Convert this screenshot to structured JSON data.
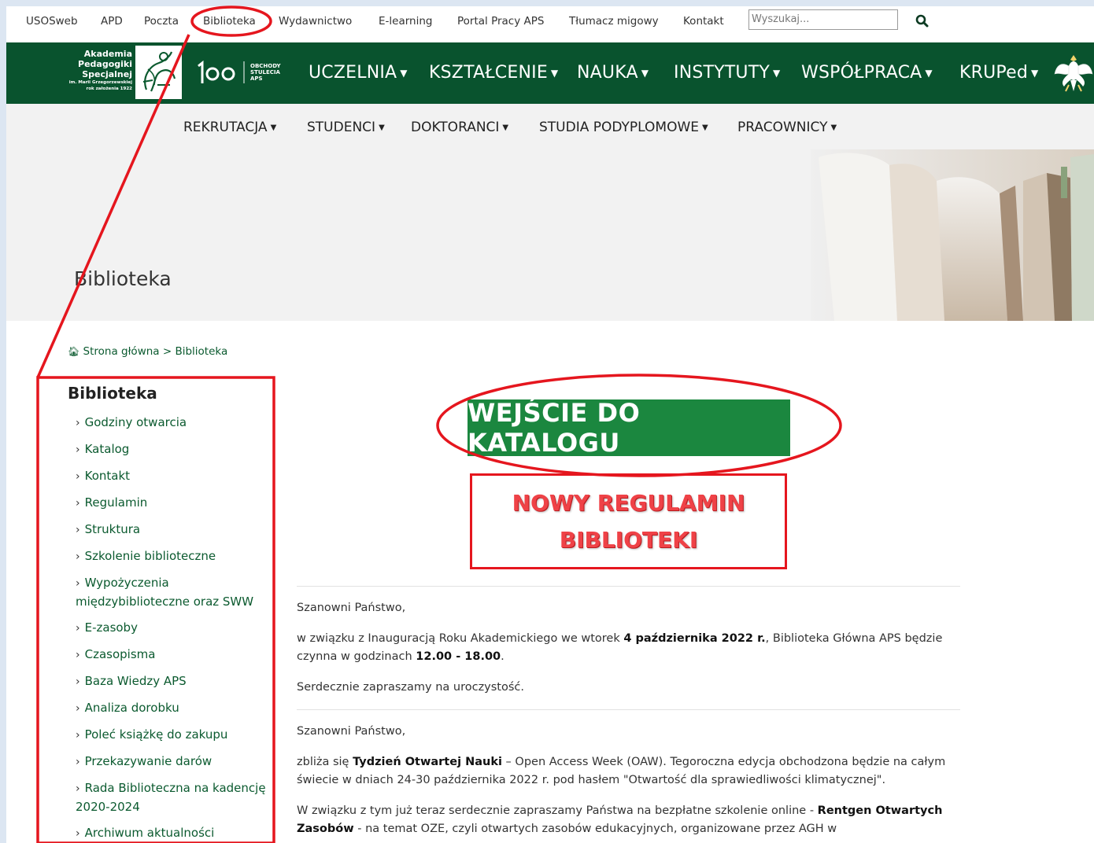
{
  "topbar": {
    "links": [
      "USOSweb",
      "APD",
      "Poczta",
      "Biblioteka",
      "Wydawnictwo",
      "E-learning",
      "Portal Pracy APS",
      "Tłumacz migowy",
      "Kontakt"
    ],
    "search_placeholder": "Wyszukaj..."
  },
  "logo": {
    "line1": "Akademia",
    "line2": "Pedagogiki",
    "line3": "Specjalnej",
    "line4": "im. Marii Grzegorzewskiej",
    "line5": "rok założenia 1922",
    "centenary_line1": "OBCHODY",
    "centenary_line2": "STULECIA",
    "centenary_line3": "APS"
  },
  "main_nav": [
    "UCZELNIA",
    "KSZTAŁCENIE",
    "NAUKA",
    "INSTYTUTY",
    "WSPÓŁPRACA",
    "KRUPed"
  ],
  "sub_nav": [
    "REKRUTACJA",
    "STUDENCI",
    "DOKTORANCI",
    "STUDIA PODYPLOMOWE",
    "PRACOWNICY"
  ],
  "hero": {
    "title": "Biblioteka"
  },
  "breadcrumb": {
    "home": "Strona główna",
    "separator": ">",
    "current": "Biblioteka"
  },
  "sidebar": {
    "title": "Biblioteka",
    "items": [
      "Godziny otwarcia",
      "Katalog",
      "Kontakt",
      "Regulamin",
      "Struktura",
      "Szkolenie biblioteczne",
      "Wypożyczenia międzybiblioteczne oraz SWW",
      "E-zasoby",
      "Czasopisma",
      "Baza Wiedzy APS",
      "Analiza dorobku",
      "Poleć książkę do zakupu",
      "Przekazywanie darów",
      "Rada Biblioteczna na kadencję 2020-2024",
      "Archiwum aktualności"
    ]
  },
  "main": {
    "catalog_button": "WEJŚCIE DO KATALOGU",
    "regulation_line1": "NOWY REGULAMIN",
    "regulation_line2": "BIBLIOTEKI",
    "greeting1": "Szanowni Państwo,",
    "p1_a": "w związku z Inauguracją Roku Akademickiego we wtorek ",
    "p1_b": "4 października 2022 r.",
    "p1_c": ", Biblioteka Główna APS będzie czynna w godzinach ",
    "p1_d": "12.00 - 18.00",
    "p1_e": ".",
    "p2": "Serdecznie zapraszamy na uroczystość.",
    "greeting2": "Szanowni Państwo,",
    "p3_a": "zbliża się ",
    "p3_b": "Tydzień Otwartej Nauki",
    "p3_c": " – Open Access Week (OAW). Tegoroczna edycja obchodzona będzie na całym świecie w dniach 24-30 października 2022 r. pod hasłem \"Otwartość dla sprawiedliwości klimatycznej\".",
    "p4_a": "W związku z tym już teraz serdecznie zapraszamy Państwa na bezpłatne szkolenie online  - ",
    "p4_b": "Rentgen Otwartych Zasobów",
    "p4_c": " - na temat OZE, czyli otwartych zasobów edukacyjnych, organizowane przez AGH w"
  },
  "colors": {
    "brand_green": "#09532e",
    "button_green": "#1b873f",
    "link_green": "#0b5a2f",
    "annotation_red": "#e5161e",
    "background": "#dce6f2"
  }
}
